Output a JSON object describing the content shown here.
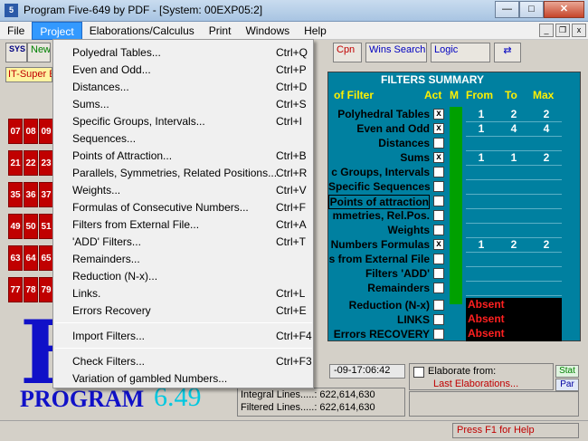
{
  "window": {
    "title": "Program Five-649 by PDF - [System: 00EXP05:2]",
    "minimize_glyph": "—",
    "maximize_glyph": "□",
    "close_glyph": "✕"
  },
  "menubar": {
    "items": [
      "File",
      "Project",
      "Elaborations/Calculus",
      "Print",
      "Windows",
      "Help"
    ],
    "mdi_min": "_",
    "mdi_restore": "❐",
    "mdi_close": "x"
  },
  "toolbar": {
    "sys_label": "SYS",
    "new_label": "New",
    "cpn_label": "Cpn",
    "wins_search_label": "Wins Search",
    "logic_label": "Logic"
  },
  "it_super": "IT-Super E",
  "numbers": [
    "07",
    "08",
    "09",
    "21",
    "22",
    "23",
    "35",
    "36",
    "37",
    "49",
    "50",
    "51",
    "63",
    "64",
    "65",
    "77",
    "78",
    "79"
  ],
  "logo": {
    "big_letter": "F",
    "program": "PROGRAM",
    "version": "6.49"
  },
  "filters": {
    "title": "FILTERS SUMMARY",
    "col_filter": "of Filter",
    "col_act": "Act",
    "col_m": "M",
    "col_from": "From",
    "col_to": "To",
    "col_max": "Max",
    "rows": [
      {
        "label": "Polyhedral Tables",
        "checked": "x",
        "from": "1",
        "to": "2",
        "max": "2"
      },
      {
        "label": "Even and Odd",
        "checked": "x",
        "from": "1",
        "to": "4",
        "max": "4"
      },
      {
        "label": "Distances",
        "checked": "",
        "from": "",
        "to": "",
        "max": ""
      },
      {
        "label": "Sums",
        "checked": "x",
        "from": "1",
        "to": "1",
        "max": "2"
      },
      {
        "label": "c Groups, Intervals",
        "checked": "",
        "from": "",
        "to": "",
        "max": ""
      },
      {
        "label": "Specific Sequences",
        "checked": "",
        "from": "",
        "to": "",
        "max": ""
      },
      {
        "label": "Points of attraction",
        "checked": "",
        "from": "",
        "to": "",
        "max": ""
      },
      {
        "label": "mmetries, Rel.Pos.",
        "checked": "",
        "from": "",
        "to": "",
        "max": ""
      },
      {
        "label": "Weights",
        "checked": "",
        "from": "",
        "to": "",
        "max": ""
      },
      {
        "label": "Numbers Formulas",
        "checked": "x",
        "from": "1",
        "to": "2",
        "max": "2"
      },
      {
        "label": "s from External File",
        "checked": "",
        "from": "",
        "to": "",
        "max": ""
      },
      {
        "label": "Filters 'ADD'",
        "checked": "",
        "from": "",
        "to": "",
        "max": ""
      },
      {
        "label": "Remainders",
        "checked": "",
        "from": "",
        "to": "",
        "max": ""
      },
      {
        "label": "Reduction (N-x)",
        "checked": "",
        "from": "",
        "to": "",
        "max": ""
      },
      {
        "label": "LINKS",
        "checked": "",
        "from": "",
        "to": "",
        "max": ""
      },
      {
        "label": "Errors RECOVERY",
        "checked": "",
        "from": "",
        "to": "",
        "max": ""
      }
    ],
    "absent": [
      "Absent",
      "Absent",
      "Absent"
    ]
  },
  "bottom": {
    "date": "-09-17:06:42",
    "elaborate_from": "Elaborate from:",
    "last_elaborations": "Last Elaborations...",
    "stat": "Stat",
    "par": "Par",
    "integral_lines": "Integral Lines.....: 622,614,630",
    "filtered_lines": "Filtered Lines.....: 622,614,630"
  },
  "status": {
    "help": "Press F1 for Help"
  },
  "dropdown": {
    "groups": [
      [
        {
          "label": "Polyedral Tables...",
          "shortcut": "Ctrl+Q"
        },
        {
          "label": "Even and Odd...",
          "shortcut": "Ctrl+P"
        },
        {
          "label": "Distances...",
          "shortcut": "Ctrl+D"
        },
        {
          "label": "Sums...",
          "shortcut": "Ctrl+S"
        },
        {
          "label": "Specific Groups, Intervals...",
          "shortcut": "Ctrl+I"
        },
        {
          "label": "Sequences...",
          "shortcut": ""
        },
        {
          "label": "Points of Attraction...",
          "shortcut": "Ctrl+B"
        },
        {
          "label": "Parallels, Symmetries, Related Positions...",
          "shortcut": "Ctrl+R"
        },
        {
          "label": "Weights...",
          "shortcut": "Ctrl+V"
        },
        {
          "label": "Formulas of Consecutive Numbers...",
          "shortcut": "Ctrl+F"
        },
        {
          "label": "Filters from External File...",
          "shortcut": "Ctrl+A"
        },
        {
          "label": "'ADD' Filters...",
          "shortcut": "Ctrl+T"
        },
        {
          "label": "Remainders...",
          "shortcut": ""
        },
        {
          "label": "Reduction (N-x)...",
          "shortcut": ""
        },
        {
          "label": "Links.",
          "shortcut": "Ctrl+L"
        },
        {
          "label": "Errors Recovery",
          "shortcut": "Ctrl+E"
        }
      ],
      [
        {
          "label": "Import Filters...",
          "shortcut": "Ctrl+F4"
        }
      ],
      [
        {
          "label": "Check Filters...",
          "shortcut": "Ctrl+F3"
        },
        {
          "label": "Variation of gambled Numbers...",
          "shortcut": ""
        }
      ]
    ]
  }
}
